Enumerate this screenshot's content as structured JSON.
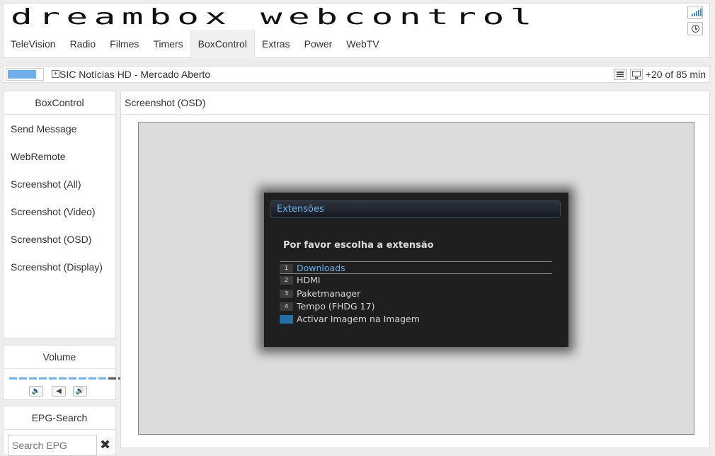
{
  "header": {
    "logo": "dreambox webcontrol",
    "nav": [
      "TeleVision",
      "Radio",
      "Filmes",
      "Timers",
      "BoxControl",
      "Extras",
      "Power",
      "WebTV"
    ],
    "active_nav": "BoxControl"
  },
  "status": {
    "signal_fill_fraction": 0.8,
    "channel": "SIC Notícias HD - Mercado Aberto",
    "expand_symbol": "+",
    "duration": "+20 of 85 min"
  },
  "sidebar": {
    "boxcontrol": {
      "title": "BoxControl",
      "items": [
        "Send Message",
        "WebRemote",
        "Screenshot (All)",
        "Screenshot (Video)",
        "Screenshot (OSD)",
        "Screenshot (Display)"
      ]
    },
    "volume": {
      "title": "Volume",
      "level_segments": 10,
      "total_segments": 12,
      "active_color": "#6fb0ea",
      "inactive_color": "#555555",
      "down_symbol": "🔈",
      "mute_symbol": "◀",
      "up_symbol": "🔊"
    },
    "epg_search": {
      "title": "EPG-Search",
      "placeholder": "Search EPG",
      "clear_symbol": "✖"
    }
  },
  "main": {
    "title": "Screenshot (OSD)",
    "osd": {
      "window_title": "Extensões",
      "prompt": "Por favor escolha a extensão",
      "items": [
        {
          "key": "1",
          "label": "Downloads",
          "selected": true
        },
        {
          "key": "2",
          "label": "HDMI",
          "selected": false
        },
        {
          "key": "3",
          "label": "Paketmanager",
          "selected": false
        },
        {
          "key": "4",
          "label": "Tempo (FHDG 17)",
          "selected": false
        },
        {
          "key": "",
          "label": "Activar Imagem na Imagem",
          "selected": false,
          "blue_key": true
        }
      ]
    }
  }
}
